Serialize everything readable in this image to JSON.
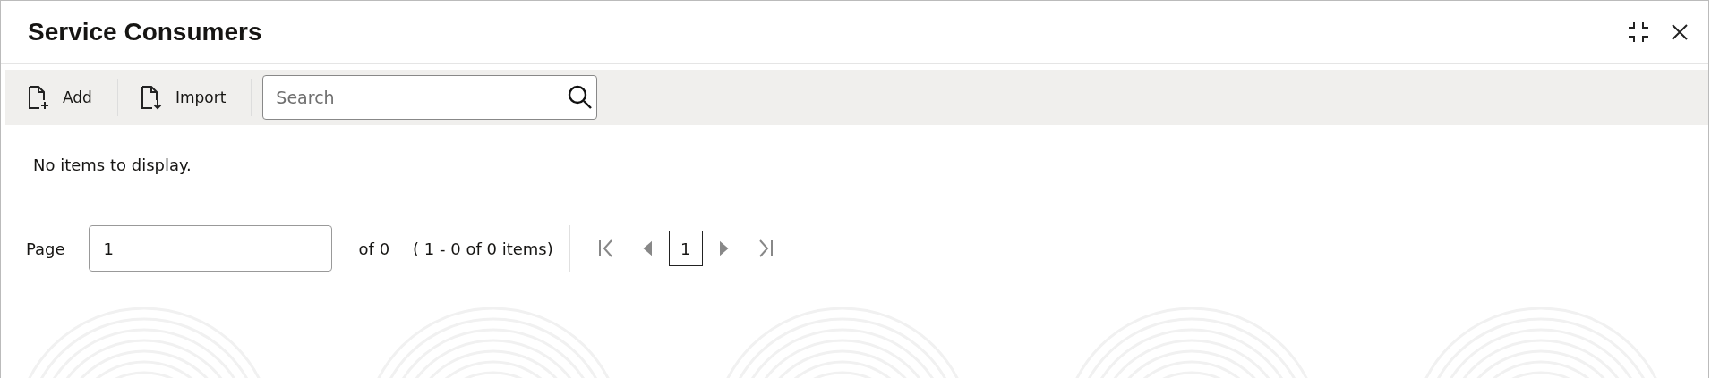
{
  "window": {
    "title": "Service Consumers"
  },
  "toolbar": {
    "buttons": [
      {
        "label": "Add",
        "kind": "add"
      },
      {
        "label": "Import",
        "kind": "import"
      }
    ],
    "search": {
      "placeholder": "Search"
    }
  },
  "message": "No items to display.",
  "pagination": {
    "page_label": "Page",
    "page_value": "1",
    "of_text": "of 0",
    "range_text": "( 1 - 0 of 0 items)",
    "nav": [
      {
        "kind": "first",
        "disabled": true
      },
      {
        "kind": "prev",
        "disabled": true
      },
      {
        "kind": "page",
        "label": "1",
        "selected": true
      },
      {
        "kind": "next",
        "disabled": true
      },
      {
        "kind": "last",
        "disabled": true
      }
    ]
  }
}
